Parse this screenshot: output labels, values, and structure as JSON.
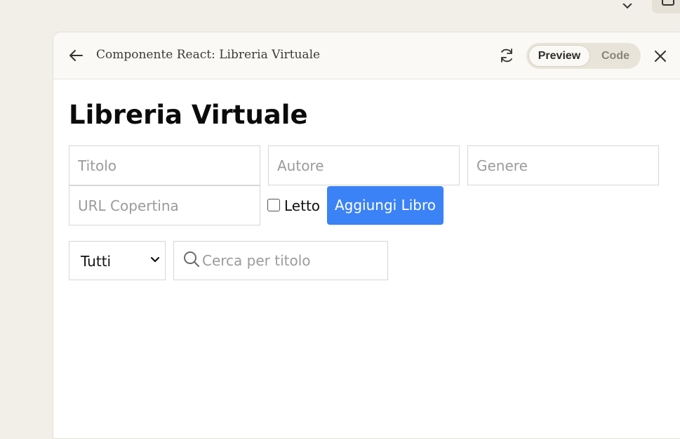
{
  "header": {
    "title": "Componente React: Libreria Virtuale",
    "toggle": {
      "preview_label": "Preview",
      "code_label": "Code",
      "active": "Preview"
    }
  },
  "icons": {
    "back": "arrow-left-icon",
    "refresh": "refresh-icon",
    "close": "close-icon",
    "search": "search-icon",
    "chevron": "chevron-down-icon"
  },
  "app": {
    "title": "Libreria Virtuale",
    "form": {
      "title_placeholder": "Titolo",
      "author_placeholder": "Autore",
      "genre_placeholder": "Genere",
      "cover_url_placeholder": "URL Copertina",
      "read_label": "Letto",
      "read_checked": false,
      "add_button_label": "Aggiungi Libro"
    },
    "filter": {
      "selected": "Tutti"
    },
    "search": {
      "placeholder": "Cerca per titolo"
    }
  },
  "colors": {
    "accent": "#3b82f6",
    "background": "#f1efe8",
    "header_bg": "#faf9f5"
  }
}
